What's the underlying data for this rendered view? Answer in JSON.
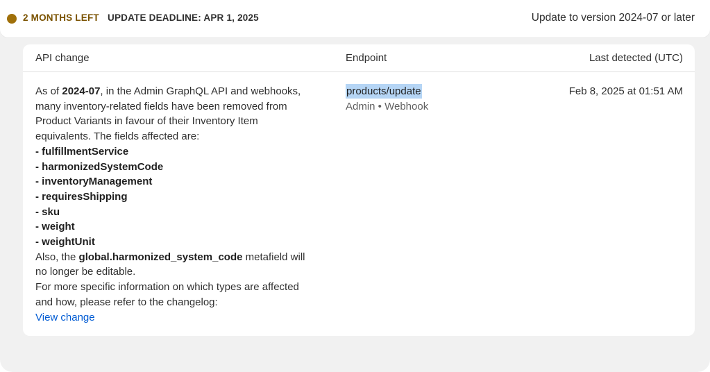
{
  "header": {
    "status": "2 MONTHS LEFT",
    "deadline": "UPDATE DEADLINE: APR 1, 2025",
    "action": "Update to version 2024-07 or later",
    "status_color": "#a0700a"
  },
  "table": {
    "columns": {
      "api_change": "API change",
      "endpoint": "Endpoint",
      "last_detected": "Last detected (UTC)"
    },
    "row": {
      "description": {
        "intro_a": "As of ",
        "version": "2024-07",
        "intro_b": ", in the Admin GraphQL API and webhooks,",
        "line2": "many inventory-related fields have been removed from",
        "line3": "Product Variants in favour of their Inventory Item",
        "line4": "equivalents. The fields affected are:",
        "fields": [
          "- fulfillmentService",
          "- harmonizedSystemCode",
          "- inventoryManagement",
          "- requiresShipping",
          "- sku",
          "- weight",
          "- weightUnit"
        ],
        "also_a": "Also, the ",
        "metafield": "global.harmonized_system_code",
        "also_b": " metafield will",
        "also_line2": "no longer be editable.",
        "more_line1": "For more specific information on which types are affected",
        "more_line2": "and how, please refer to the changelog:",
        "link": "View change"
      },
      "endpoint": {
        "name": "products/update",
        "meta": "Admin • Webhook"
      },
      "last_detected": "Feb 8, 2025 at 01:51 AM"
    }
  },
  "colors": {
    "link": "#005bd3",
    "selection": "#b5d5f5"
  }
}
